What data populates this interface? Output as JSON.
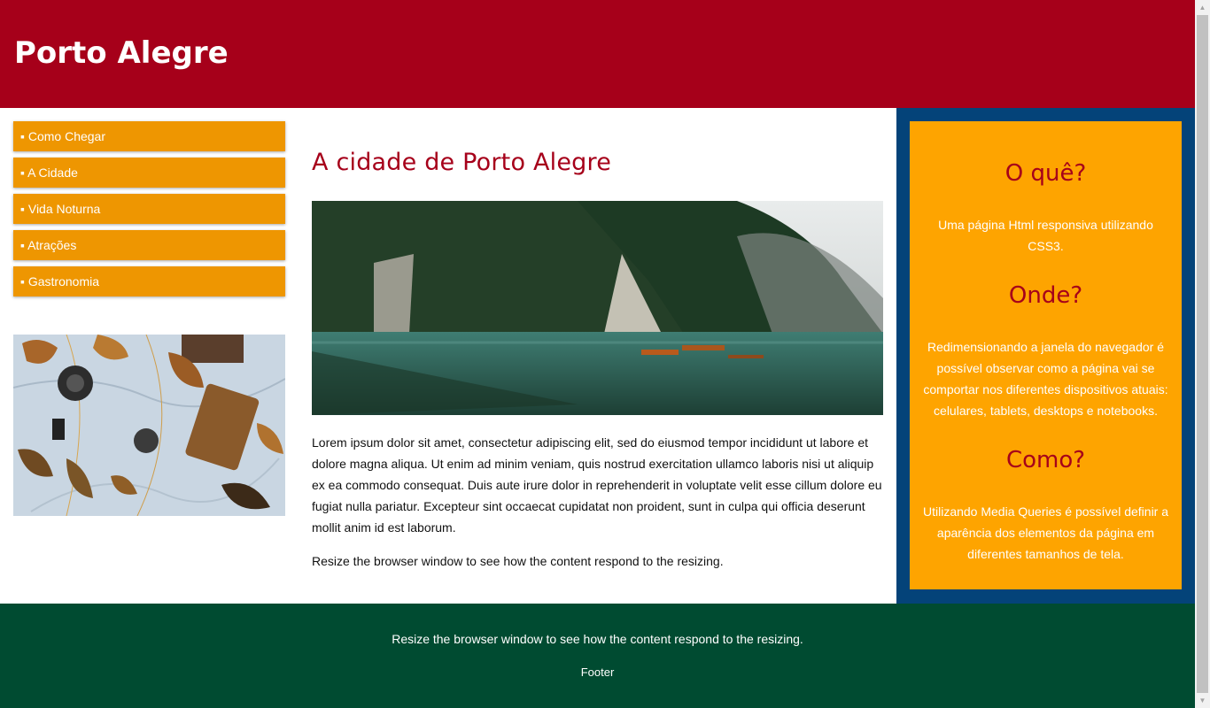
{
  "header": {
    "title": "Porto Alegre"
  },
  "nav": {
    "items": [
      {
        "label": "▪ Como Chegar"
      },
      {
        "label": "▪ A Cidade"
      },
      {
        "label": "▪ Vida Noturna"
      },
      {
        "label": "▪ Atrações"
      },
      {
        "label": "▪ Gastronomia"
      }
    ]
  },
  "main": {
    "title": "A cidade de Porto Alegre",
    "paragraph1": "Lorem ipsum dolor sit amet, consectetur adipiscing elit, sed do eiusmod tempor incididunt ut labore et dolore magna aliqua. Ut enim ad minim veniam, quis nostrud exercitation ullamco laboris nisi ut aliquip ex ea commodo consequat. Duis aute irure dolor in reprehenderit in voluptate velit esse cillum dolore eu fugiat nulla pariatur. Excepteur sint occaecat cupidatat non proident, sunt in culpa qui officia deserunt mollit anim id est laborum.",
    "paragraph2": "Resize the browser window to see how the content respond to the resizing."
  },
  "aside": {
    "sections": [
      {
        "title": "O quê?",
        "text": "Uma página Html responsiva utilizando CSS3."
      },
      {
        "title": "Onde?",
        "text": "Redimensionando a janela do navegador é possível observar como a página vai se comportar nos diferentes dispositivos atuais: celulares, tablets, desktops e notebooks."
      },
      {
        "title": "Como?",
        "text": "Utilizando Media Queries é possível definir a aparência dos elementos da página em diferentes tamanhos de tela."
      }
    ]
  },
  "footer": {
    "text": "Resize the browser window to see how the content respond to the resizing.",
    "label": "Footer"
  },
  "colors": {
    "header_bg": "#a6001a",
    "nav_bg": "#ee9601",
    "aside_outer_bg": "#044379",
    "aside_inner_bg": "#fea400",
    "footer_bg": "#004b31"
  }
}
